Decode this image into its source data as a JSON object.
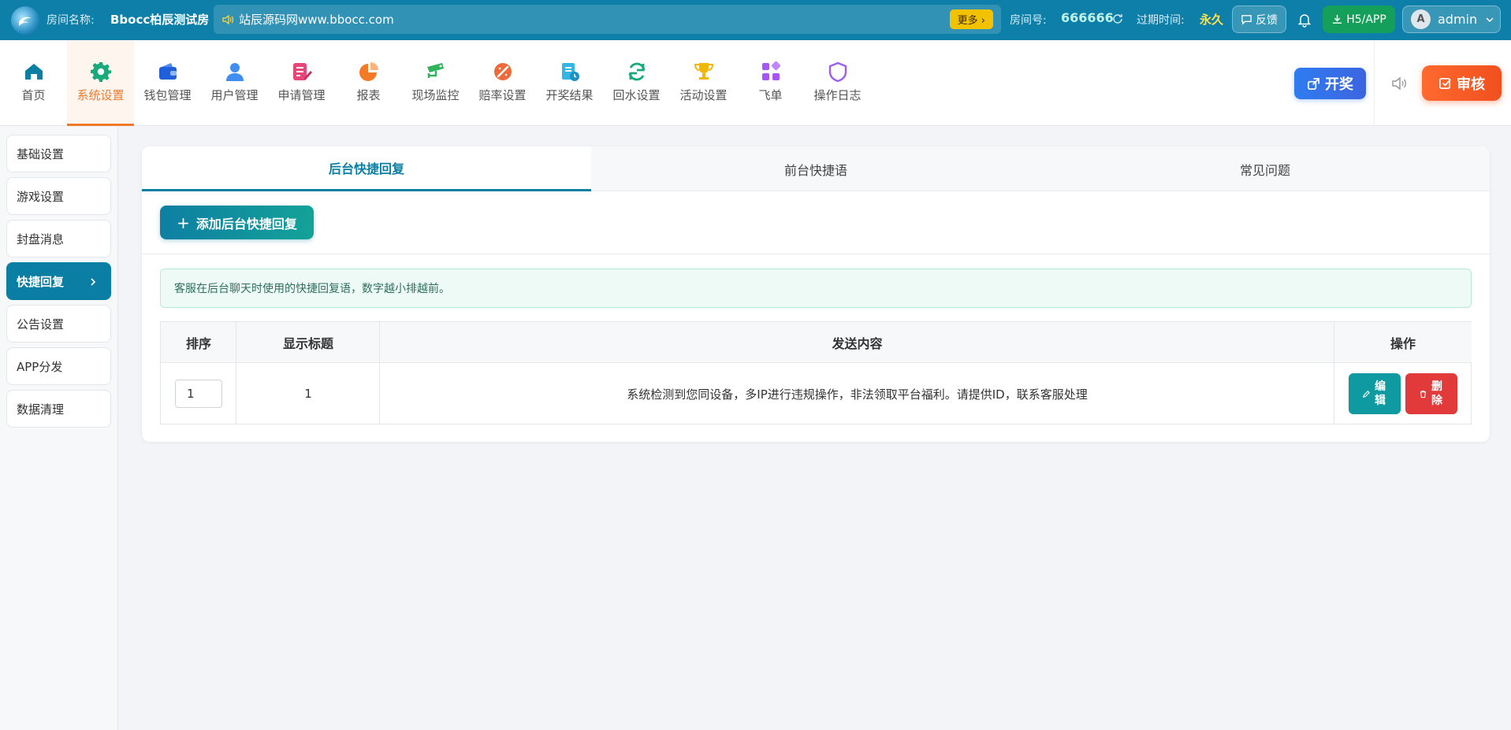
{
  "header": {
    "room_label": "房间名称:",
    "room_name": "Bbocc柏辰测试房",
    "marquee": "站辰源码网www.bbocc.com",
    "more_label": "更多 ›",
    "room_no_label": "房间号:",
    "room_no": "666666",
    "expire_label": "过期时间:",
    "expire_value": "永久",
    "feedback_label": "反馈",
    "h5_label": "H5/APP",
    "avatar_letter": "A",
    "user_name": "admin"
  },
  "nav": {
    "items": [
      {
        "label": "首页",
        "icon": "home-icon"
      },
      {
        "label": "系统设置",
        "icon": "gear-icon"
      },
      {
        "label": "钱包管理",
        "icon": "wallet-icon"
      },
      {
        "label": "用户管理",
        "icon": "user-icon"
      },
      {
        "label": "申请管理",
        "icon": "apply-icon"
      },
      {
        "label": "报表",
        "icon": "pie-chart-icon"
      },
      {
        "label": "现场监控",
        "icon": "camera-icon"
      },
      {
        "label": "赔率设置",
        "icon": "odds-icon"
      },
      {
        "label": "开奖结果",
        "icon": "result-icon"
      },
      {
        "label": "回水设置",
        "icon": "refresh-icon"
      },
      {
        "label": "活动设置",
        "icon": "trophy-icon"
      },
      {
        "label": "飞单",
        "icon": "grid-icon"
      },
      {
        "label": "操作日志",
        "icon": "shield-icon"
      }
    ],
    "active": "系统设置",
    "draw_label": "开奖",
    "review_label": "审核"
  },
  "sidebar": {
    "items": [
      {
        "label": "基础设置"
      },
      {
        "label": "游戏设置"
      },
      {
        "label": "封盘消息"
      },
      {
        "label": "快捷回复"
      },
      {
        "label": "公告设置"
      },
      {
        "label": "APP分发"
      },
      {
        "label": "数据清理"
      }
    ],
    "active": "快捷回复"
  },
  "main": {
    "tabs": [
      {
        "label": "后台快捷回复"
      },
      {
        "label": "前台快捷语"
      },
      {
        "label": "常见问题"
      }
    ],
    "add_button": "添加后台快捷回复",
    "notice": "客服在后台聊天时使用的快捷回复语，数字越小排越前。",
    "table": {
      "headers": [
        "排序",
        "显示标题",
        "发送内容",
        "操作"
      ],
      "rows": [
        {
          "sort": "1",
          "title": "1",
          "content": "系统检测到您同设备，多IP进行违规操作，非法领取平台福利。请提供ID，联系客服处理",
          "edit": "编辑",
          "delete": "删除"
        }
      ]
    }
  },
  "colors": {
    "topbar": "#0d7fa8",
    "accent": "#0a7ea3",
    "active_nav": "#f07a2c",
    "danger": "#e23a3a",
    "success": "#14a05a",
    "highlight": "#f2c200"
  }
}
